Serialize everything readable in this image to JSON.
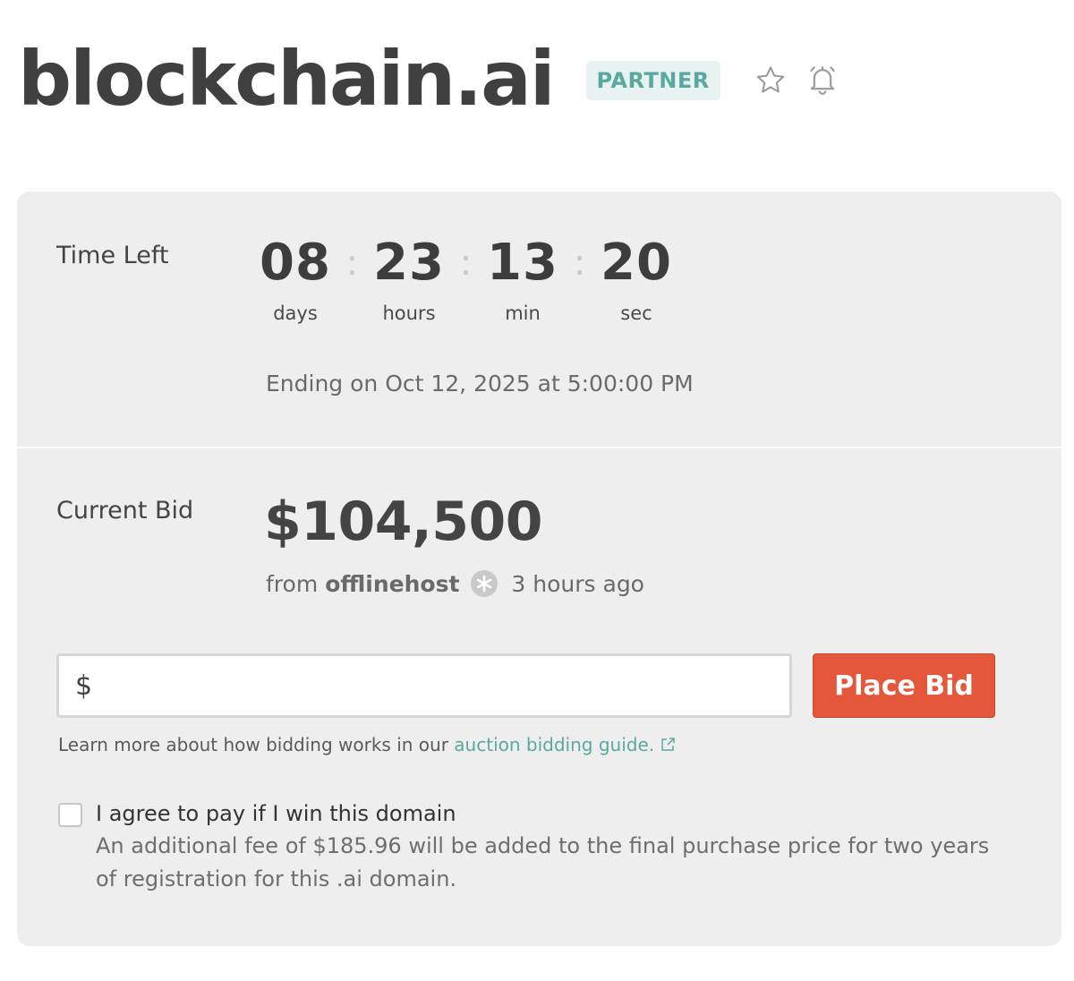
{
  "header": {
    "domain": "blockchain.ai",
    "badge": "PARTNER",
    "icons": {
      "favorite": "star-icon",
      "alert": "bell-icon"
    }
  },
  "auction": {
    "time_left_label": "Time Left",
    "countdown": [
      {
        "value": "08",
        "unit": "days"
      },
      {
        "value": "23",
        "unit": "hours"
      },
      {
        "value": "13",
        "unit": "min"
      },
      {
        "value": "20",
        "unit": "sec"
      }
    ],
    "separator": ":",
    "ending": "Ending on Oct 12, 2025 at 5:00:00 PM",
    "current_bid_label": "Current Bid",
    "current_bid": "$104,500",
    "from_label": "from",
    "bidder": "offlinehost",
    "bid_time": "3 hours ago"
  },
  "bid_form": {
    "currency_symbol": "$",
    "input_value": "",
    "place_bid_label": "Place Bid",
    "guide_prefix": "Learn more about how bidding works in our",
    "guide_link": "auction bidding guide.",
    "agree_label": "I agree to pay if I win this domain",
    "fee_note": "An additional fee of $185.96 will be added to the final purchase price for two years of registration for this .ai domain."
  },
  "colors": {
    "accent": "#5aa9a1",
    "button": "#e4573b",
    "panel": "#eeeeee"
  }
}
